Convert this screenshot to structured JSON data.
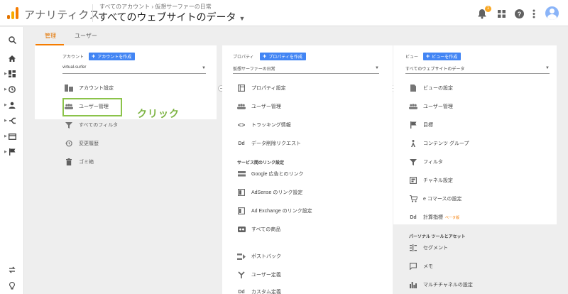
{
  "colors": {
    "accent": "#f57c00",
    "primary_button": "#4285f4",
    "highlight": "#8bc34a",
    "badge": "#f9a825"
  },
  "app": {
    "name": "アナリティクス"
  },
  "header": {
    "breadcrumb": "すべてのアカウント › 仮想サーファーの日常",
    "view_title": "すべてのウェブサイトのデータ",
    "notification_count": "1"
  },
  "tabs": [
    {
      "label": "管理"
    },
    {
      "label": "ユーザー"
    }
  ],
  "account": {
    "heading": "アカウント",
    "create_label": "アカウントを作成",
    "selected": "virtual-surfer",
    "items": [
      {
        "label": "アカウント設定",
        "icon": "building-icon"
      },
      {
        "label": "ユーザー管理",
        "icon": "people-icon"
      },
      {
        "label": "すべてのフィルタ",
        "icon": "filter-icon"
      },
      {
        "label": "変更履歴",
        "icon": "history-icon"
      },
      {
        "label": "ゴミ箱",
        "icon": "trash-icon"
      }
    ]
  },
  "annotation": {
    "click_text": "クリック"
  },
  "property": {
    "heading": "プロパティ",
    "create_label": "プロパティを作成",
    "selected": "仮想サーファーの日常",
    "items": [
      {
        "label": "プロパティ設定",
        "icon": "property-icon"
      },
      {
        "label": "ユーザー管理",
        "icon": "people-icon"
      },
      {
        "label": "トラッキング情報",
        "icon": "code-icon"
      },
      {
        "label": "データ削除リクエスト",
        "icon": "dd-icon"
      }
    ],
    "links_section": "サービス間のリンク設定",
    "link_items": [
      {
        "label": "Google 広告とのリンク",
        "icon": "ads-icon"
      },
      {
        "label": "AdSense のリンク設定",
        "icon": "adsense-icon"
      },
      {
        "label": "Ad Exchange のリンク設定",
        "icon": "adexchange-icon"
      },
      {
        "label": "すべての商品",
        "icon": "products-icon"
      },
      {
        "label": "ポストバック",
        "icon": "postback-icon"
      },
      {
        "label": "ユーザー定義",
        "icon": "fork-icon"
      },
      {
        "label": "カスタム定義",
        "icon": "dd-icon"
      }
    ]
  },
  "view": {
    "heading": "ビュー",
    "create_label": "ビューを作成",
    "selected": "すべてのウェブサイトのデータ",
    "items": [
      {
        "label": "ビューの設定",
        "icon": "document-icon"
      },
      {
        "label": "ユーザー管理",
        "icon": "people-icon"
      },
      {
        "label": "目標",
        "icon": "flag-icon"
      },
      {
        "label": "コンテンツ グループ",
        "icon": "person-run-icon"
      },
      {
        "label": "フィルタ",
        "icon": "filter-icon"
      },
      {
        "label": "チャネル設定",
        "icon": "channel-icon"
      },
      {
        "label": "e コマースの設定",
        "icon": "cart-icon"
      },
      {
        "label": "計算指標",
        "icon": "dd-icon",
        "tag": "ベータ版"
      }
    ],
    "personal_section": "パーソナル ツールとアセット",
    "personal_items": [
      {
        "label": "セグメント",
        "icon": "segment-icon"
      },
      {
        "label": "メモ",
        "icon": "comment-icon"
      },
      {
        "label": "マルチチャネルの設定",
        "icon": "bars-icon"
      }
    ]
  }
}
